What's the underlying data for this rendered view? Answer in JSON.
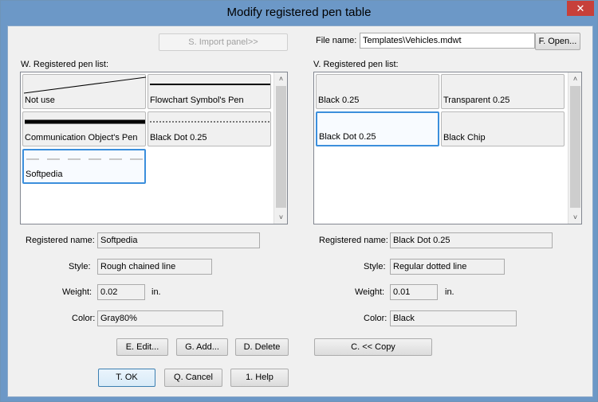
{
  "window": {
    "title": "Modify registered pen table",
    "close_glyph": "✕"
  },
  "import_button": "S. Import panel>>",
  "file": {
    "label": "File name:",
    "value": "Templates\\Vehicles.mdwt",
    "open_button": "F. Open..."
  },
  "left": {
    "list_label": "W. Registered pen list:",
    "pens": [
      {
        "name": "Not use",
        "style": "diagonal"
      },
      {
        "name": "Flowchart Symbol's Pen",
        "style": "solid-medium"
      },
      {
        "name": "Communication Object's Pen",
        "style": "solid-thick"
      },
      {
        "name": "Black Dot 0.25",
        "style": "dotted"
      },
      {
        "name": "Softpedia",
        "style": "dashed-gray",
        "selected": true
      }
    ],
    "registered_name_label": "Registered name:",
    "registered_name": "Softpedia",
    "style_label": "Style:",
    "style": "Rough chained line",
    "weight_label": "Weight:",
    "weight": "0.02",
    "weight_unit": "in.",
    "color_label": "Color:",
    "color": "Gray80%",
    "edit_button": "E. Edit...",
    "add_button": "G. Add...",
    "delete_button": "D. Delete"
  },
  "right": {
    "list_label": "V. Registered pen list:",
    "pens": [
      {
        "name": "Black 0.25"
      },
      {
        "name": "Transparent 0.25"
      },
      {
        "name": "Black Dot 0.25",
        "selected": true
      },
      {
        "name": "Black Chip"
      }
    ],
    "registered_name_label": "Registered name:",
    "registered_name": "Black Dot 0.25",
    "style_label": "Style:",
    "style": "Regular dotted line",
    "weight_label": "Weight:",
    "weight": "0.01",
    "weight_unit": "in.",
    "color_label": "Color:",
    "color": "Black",
    "copy_button": "C. << Copy"
  },
  "footer": {
    "ok_button": "T. OK",
    "cancel_button": "Q. Cancel",
    "help_button": "1. Help"
  },
  "colors": {
    "titlebar": "#6c98c7",
    "selection": "#3c8fdc",
    "dialog_bg": "#f0f0f0"
  },
  "icons": {
    "scroll_up": "˄",
    "scroll_down": "˅"
  }
}
